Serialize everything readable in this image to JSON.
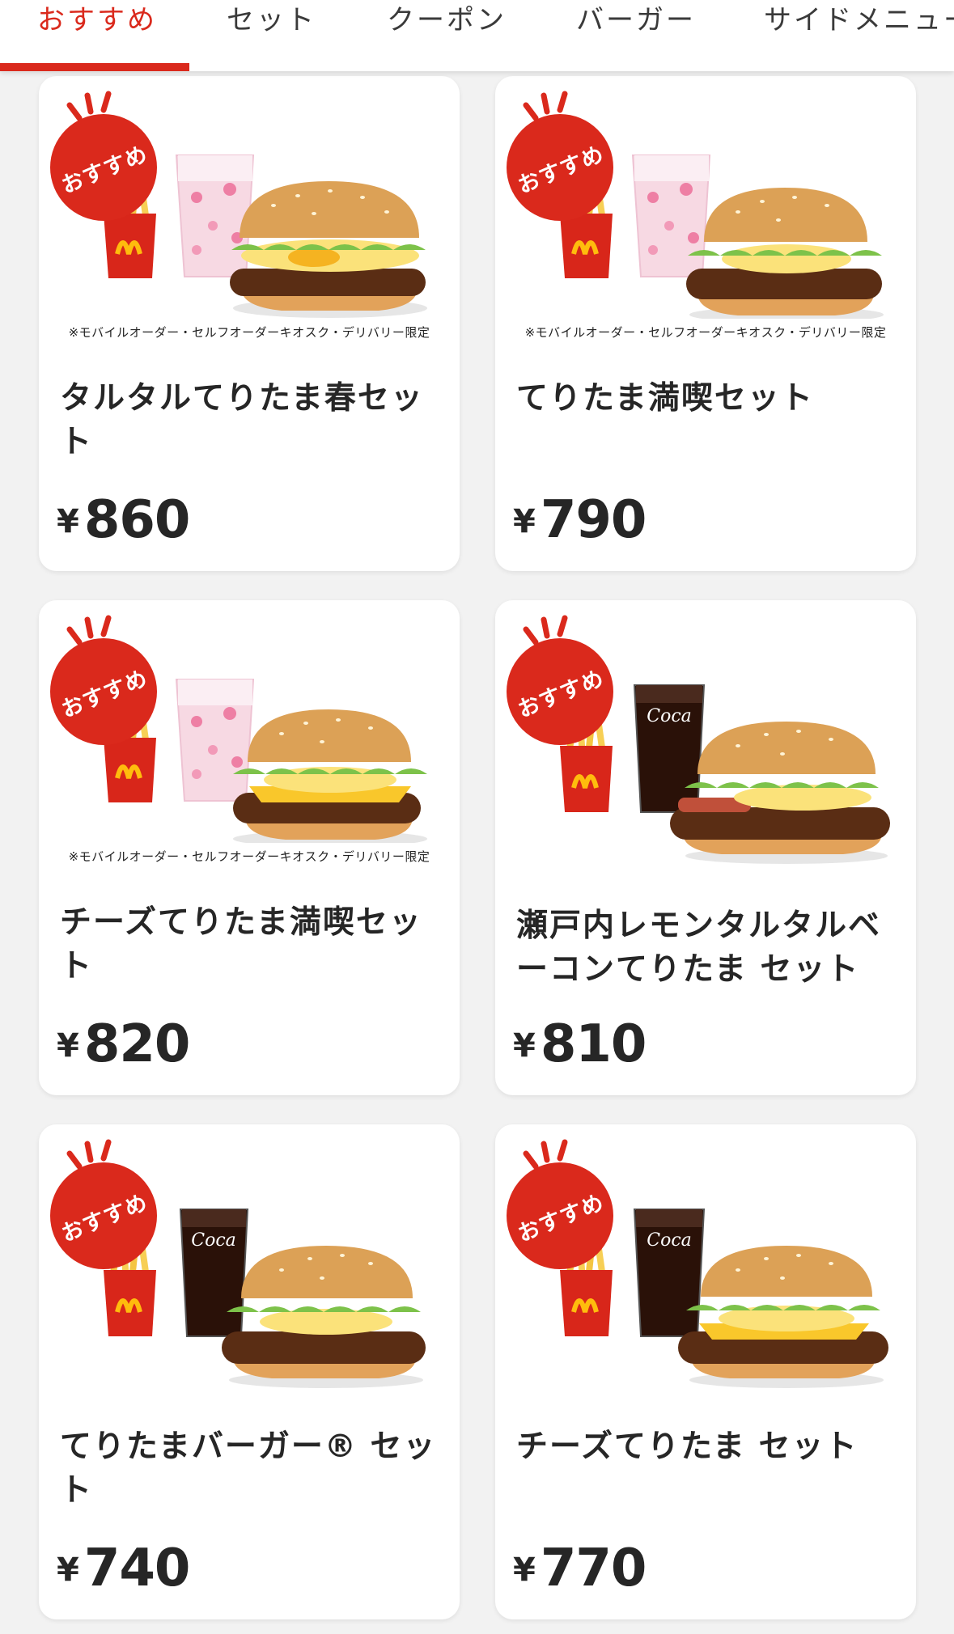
{
  "tabs": [
    {
      "label": "おすすめ",
      "active": true
    },
    {
      "label": "セット",
      "active": false
    },
    {
      "label": "クーポン",
      "active": false
    },
    {
      "label": "バーガー",
      "active": false
    },
    {
      "label": "サイドメニュー",
      "active": false
    }
  ],
  "badge_label": "おすすめ",
  "products": [
    {
      "name": "タルタルてりたま春セット",
      "currency": "¥",
      "price": "860",
      "note": "※モバイルオーダー・セルフオーダーキオスク・デリバリー限定",
      "drink": "sakura-drink-icon",
      "burger": "teritama-tartar-bacon-icon"
    },
    {
      "name": "てりたま満喫セット",
      "currency": "¥",
      "price": "790",
      "note": "※モバイルオーダー・セルフオーダーキオスク・デリバリー限定",
      "drink": "sakura-drink-icon",
      "burger": "teritama-mankitsu-icon"
    },
    {
      "name": "チーズてりたま満喫セット",
      "currency": "¥",
      "price": "820",
      "note": "※モバイルオーダー・セルフオーダーキオスク・デリバリー限定",
      "drink": "sakura-drink-icon",
      "burger": "cheese-teritama-mankitsu-icon"
    },
    {
      "name": "瀬戸内レモンタルタルベーコンてりたま セット",
      "currency": "¥",
      "price": "810",
      "note": "",
      "drink": "cola-drink-icon",
      "burger": "lemon-tartar-bacon-teritama-icon"
    },
    {
      "name": "てりたまバーガー® セット",
      "currency": "¥",
      "price": "740",
      "note": "",
      "drink": "cola-drink-icon",
      "burger": "teritama-burger-icon"
    },
    {
      "name": "チーズてりたま セット",
      "currency": "¥",
      "price": "770",
      "note": "",
      "drink": "cola-drink-icon",
      "burger": "cheese-teritama-icon"
    }
  ],
  "colors": {
    "accent": "#da291c",
    "arches": "#ffbc0d",
    "text": "#262626",
    "background": "#f2f2f2"
  }
}
